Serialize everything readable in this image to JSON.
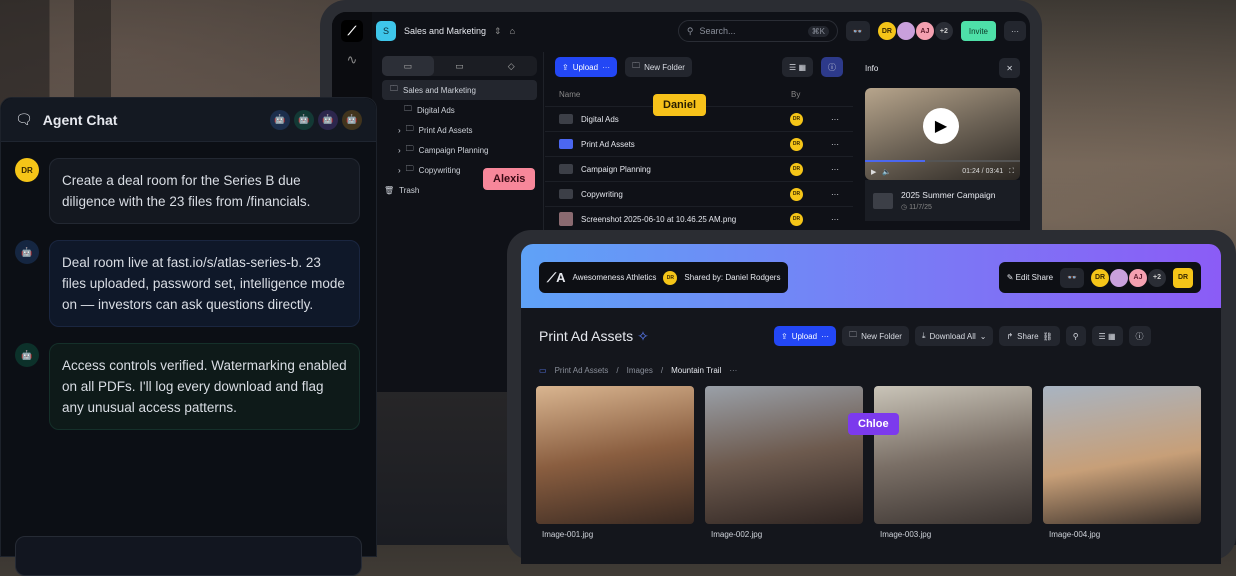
{
  "back_window": {
    "workspace_initial": "S",
    "workspace_name": "Sales and Marketing",
    "search_placeholder": "Search...",
    "search_shortcut": "⌘K",
    "avatars": [
      "DR",
      "AJ"
    ],
    "avatar_more": "+2",
    "invite_label": "Invite",
    "tree": [
      "Sales and Marketing",
      "Digital Ads",
      "Print Ad Assets",
      "Campaign Planning",
      "Copywriting",
      "Trash"
    ],
    "upload_label": "Upload",
    "new_folder_label": "New Folder",
    "columns": {
      "name": "Name",
      "by": "By"
    },
    "files": [
      {
        "name": "Digital Ads",
        "by": "DR"
      },
      {
        "name": "Print Ad Assets",
        "by": "DR"
      },
      {
        "name": "Campaign Planning",
        "by": "DR"
      },
      {
        "name": "Copywriting",
        "by": "DR"
      },
      {
        "name": "Screenshot 2025-06-10 at 10.46.25 AM.png",
        "by": "DR"
      }
    ],
    "info": {
      "title": "Info",
      "video_time": "01:24 / 03:41",
      "video_progress": 0.39,
      "folder_name": "2025 Summer Campaign",
      "folder_date": "11/7/25"
    },
    "cursors": {
      "daniel": "Daniel",
      "alexis": "Alexis"
    }
  },
  "chat": {
    "title": "Agent Chat",
    "agent_colors": [
      "#3b82f6",
      "#10b981",
      "#8b5cf6",
      "#f59e0b"
    ],
    "messages": [
      {
        "from": "DR",
        "text": "Create a deal room for the Series B due diligence with the 23 files from /financials."
      },
      {
        "from": "agent-blue",
        "text": "Deal room live at fast.io/s/atlas-series-b. 23 files uploaded, password set, intelligence mode on — investors can ask questions directly."
      },
      {
        "from": "agent-green",
        "text": "Access controls verified. Watermarking enabled on all PDFs. I'll log every download and flag any unusual access patterns."
      }
    ]
  },
  "front_window": {
    "brand": "Awesomeness Athletics",
    "shared_by_avatar": "DR",
    "shared_by": "Shared by: Daniel Rodgers",
    "edit_share": "Edit Share",
    "avatars": [
      "DR",
      "AJ"
    ],
    "avatar_more": "+2",
    "me": "DR",
    "title": "Print Ad Assets",
    "upload_label": "Upload",
    "new_folder_label": "New Folder",
    "download_all_label": "Download All",
    "share_label": "Share",
    "breadcrumb": [
      "Print Ad Assets",
      "Images",
      "Mountain Trail"
    ],
    "images": [
      "Image-001.jpg",
      "Image-002.jpg",
      "Image-003.jpg",
      "Image-004.jpg"
    ],
    "cursor_chloe": "Chloe"
  }
}
